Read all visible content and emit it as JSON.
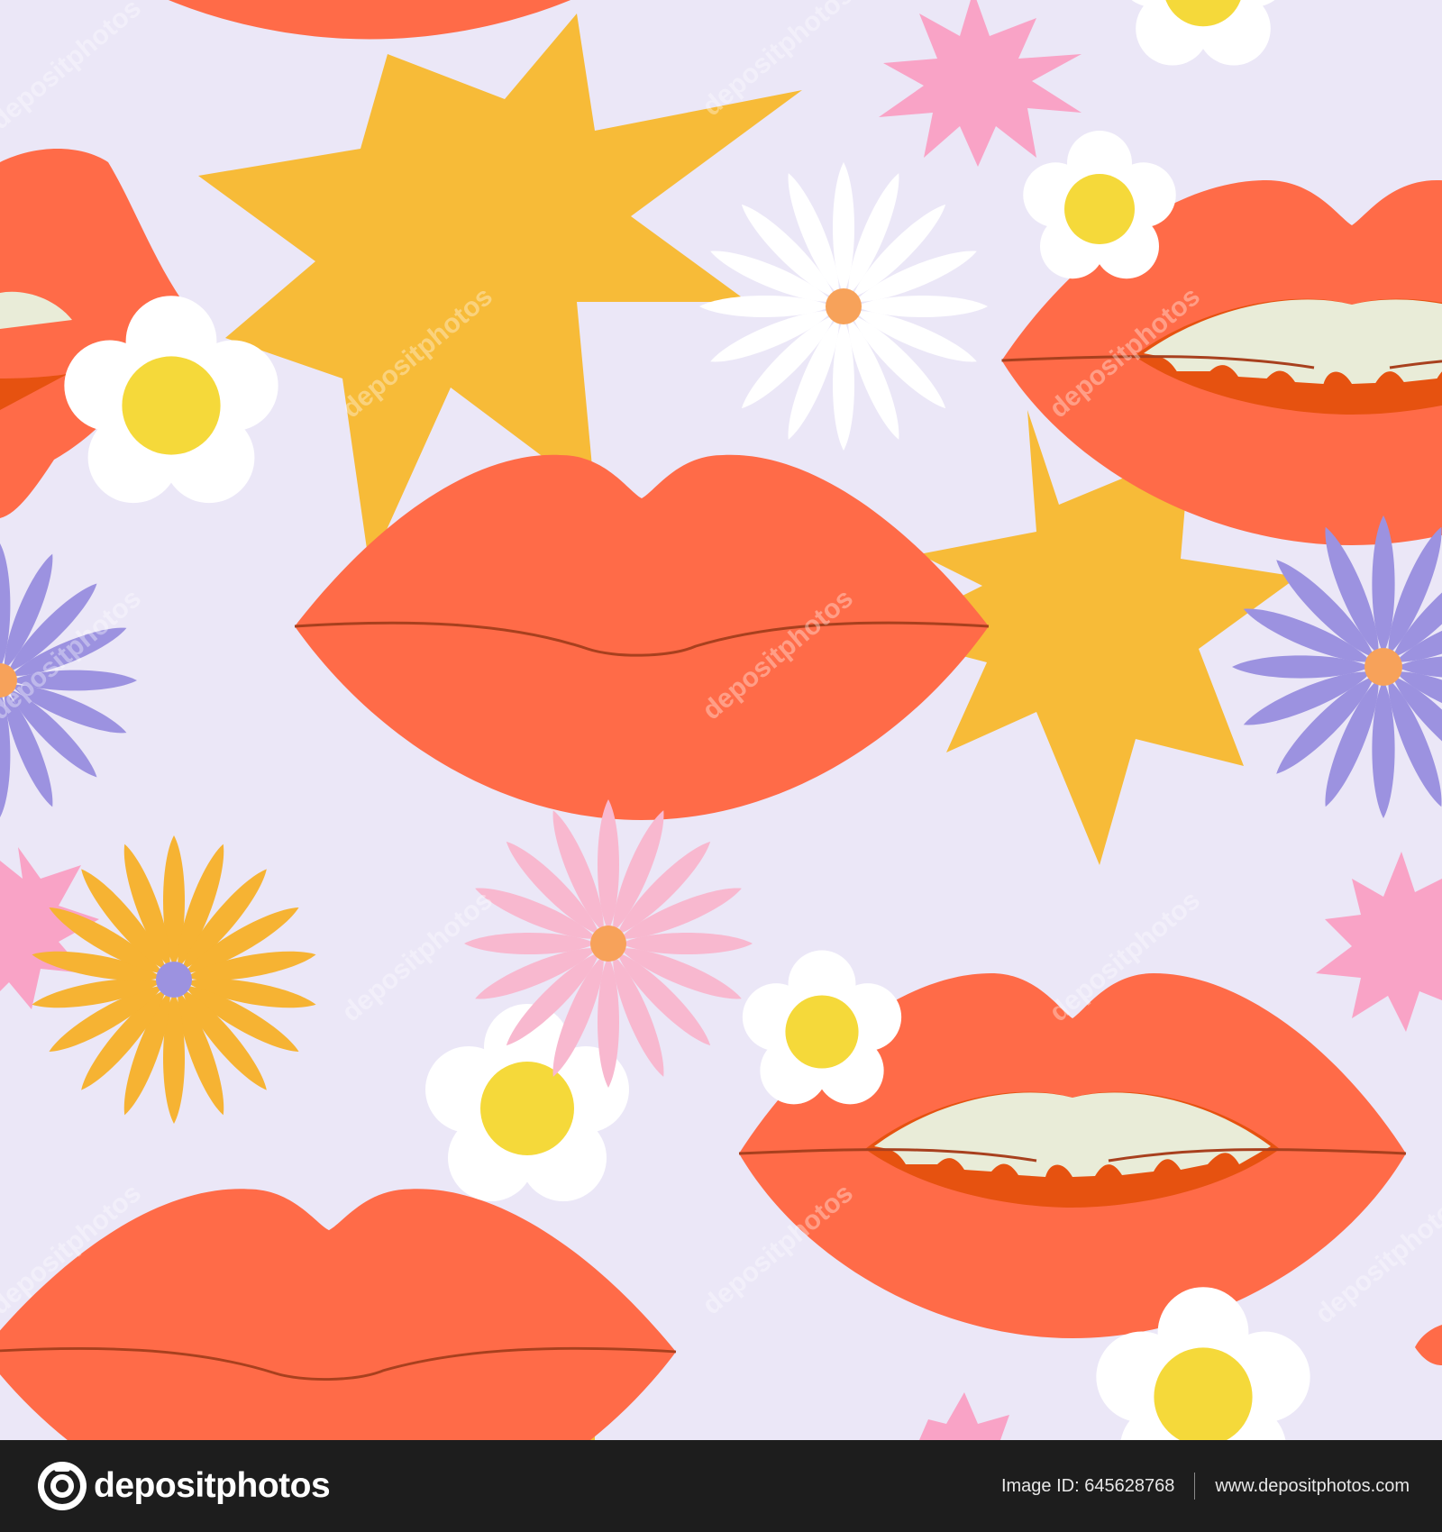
{
  "artwork": {
    "watermark_text": "depositphotos",
    "colors": {
      "background": "#ebe7f7",
      "lips": "#ff6b48",
      "lip_line": "#a8401e",
      "mouth_inner": "#e65210",
      "teeth": "#e9ecd8",
      "star_yellow": "#f7bb38",
      "star_pink": "#f9a3c6",
      "daisy_white": "#ffffff",
      "daisy_center": "#f5d93a",
      "flower_purple": "#9c92e0",
      "flower_pink": "#f8b8cf",
      "flower_orange": "#f6b333",
      "center_orange": "#f7a25a"
    }
  },
  "footer": {
    "brand": "depositphotos",
    "image_id": "Image ID: 645628768",
    "site": "www.depositphotos.com"
  }
}
